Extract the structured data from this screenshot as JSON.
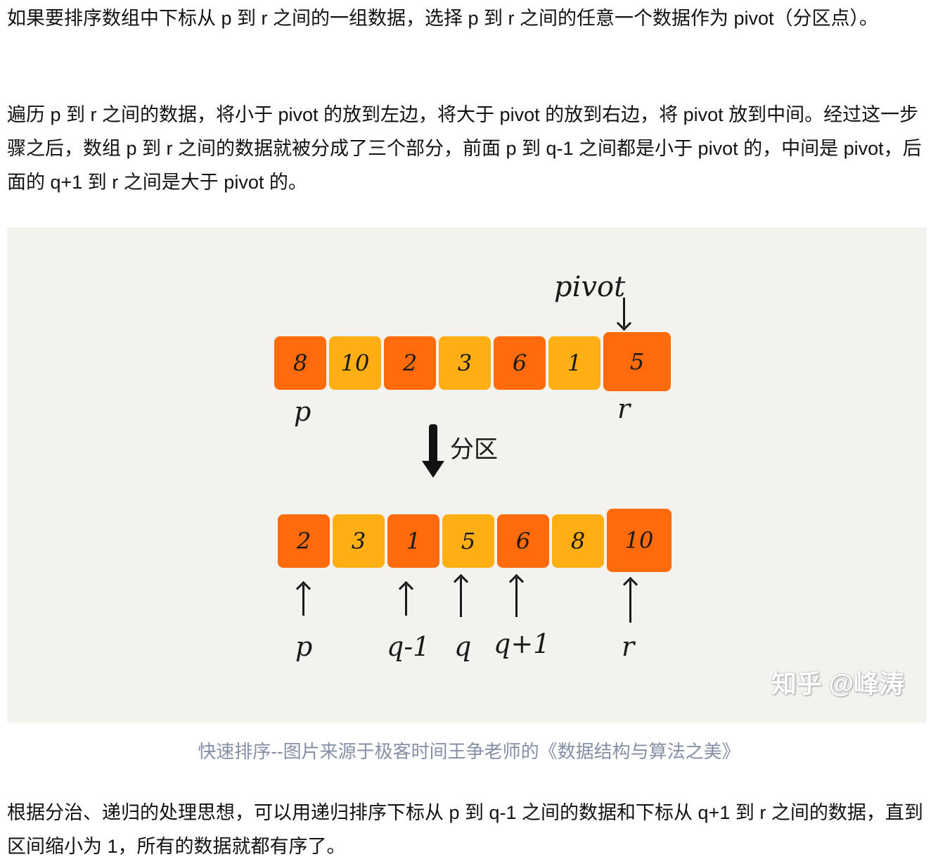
{
  "paragraphs": [
    "如果要排序数组中下标从 p 到 r 之间的一组数据，选择 p 到 r 之间的任意一个数据作为 pivot（分区点）。",
    "遍历 p 到 r 之间的数据，将小于 pivot 的放到左边，将大于 pivot 的放到右边，将 pivot 放到中间。经过这一步骤之后，数组 p 到 r 之间的数据就被分成了三个部分，前面 p 到 q-1 之间都是小于 pivot 的，中间是 pivot，后面的 q+1 到 r 之间是大于 pivot 的。",
    "根据分治、递归的处理思想，可以用递归排序下标从 p 到 q-1 之间的数据和下标从 q+1 到 r 之间的数据，直到区间缩小为 1，所有的数据就都有序了。"
  ],
  "figure": {
    "before": [
      "8",
      "10",
      "2",
      "3",
      "6",
      "1",
      "5"
    ],
    "after": [
      "2",
      "3",
      "1",
      "5",
      "6",
      "8",
      "10"
    ],
    "pivot_label": "pivot",
    "partition_label": "分区",
    "before_labels": {
      "p": "p",
      "r": "r"
    },
    "after_labels": {
      "p": "p",
      "q_minus_1": "q-1",
      "q": "q",
      "q_plus_1": "q+1",
      "r": "r"
    },
    "watermark": "知乎 @峰涛",
    "colors": {
      "dark": "#ff6a0a",
      "light": "#ffae14",
      "background": "#f3f2ef"
    }
  },
  "caption": "快速排序--图片来源于极客时间王争老师的《数据结构与算法之美》"
}
